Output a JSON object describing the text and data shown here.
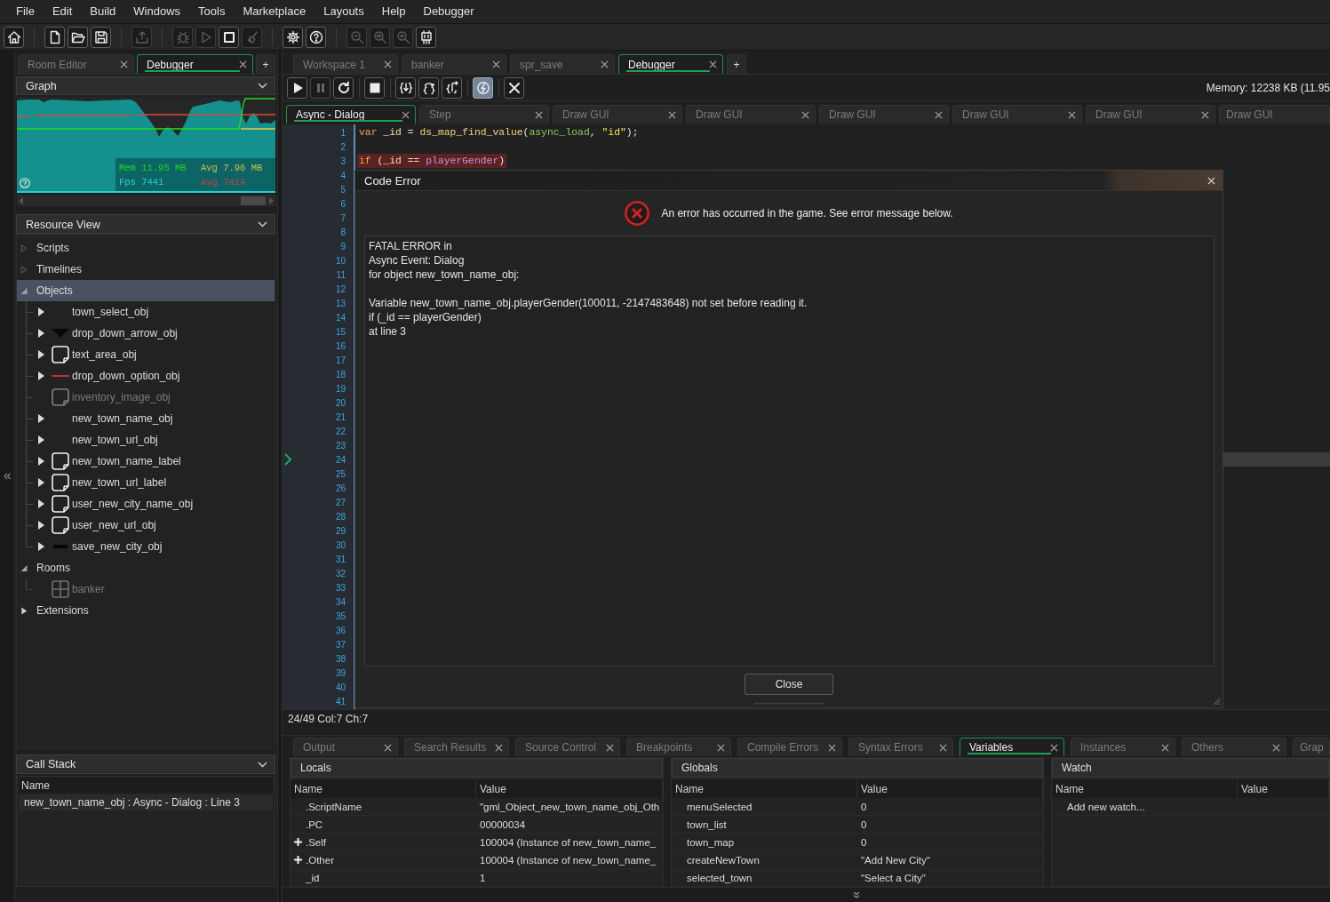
{
  "menu": [
    "File",
    "Edit",
    "Build",
    "Windows",
    "Tools",
    "Marketplace",
    "Layouts",
    "Help",
    "Debugger"
  ],
  "toolbar": [
    {
      "buttons": [
        {
          "kind": "home",
          "disabled": false
        }
      ]
    },
    {
      "buttons": [
        {
          "kind": "new",
          "disabled": false
        },
        {
          "kind": "open",
          "disabled": false
        },
        {
          "kind": "save",
          "disabled": false
        }
      ]
    },
    {
      "buttons": [
        {
          "kind": "export",
          "disabled": true
        }
      ]
    },
    {
      "buttons": [
        {
          "kind": "debug",
          "disabled": true
        },
        {
          "kind": "run",
          "disabled": true
        },
        {
          "kind": "stop",
          "disabled": false
        },
        {
          "kind": "clean",
          "disabled": true
        }
      ]
    },
    {
      "buttons": [
        {
          "kind": "settings",
          "disabled": false
        },
        {
          "kind": "help",
          "disabled": false
        }
      ]
    },
    {
      "buttons": [
        {
          "kind": "zoomout",
          "disabled": true
        },
        {
          "kind": "zoomreset",
          "disabled": true
        },
        {
          "kind": "zoomin",
          "disabled": true
        },
        {
          "kind": "device",
          "disabled": false
        }
      ]
    }
  ],
  "left_panel": {
    "tabs": [
      {
        "label": "Room Editor",
        "selected": false
      },
      {
        "label": "Debugger",
        "selected": true
      }
    ],
    "add_tab": "+",
    "graph": {
      "title": "Graph",
      "stats": [
        {
          "text": "Mem 11.95 MB",
          "color": "#22d422"
        },
        {
          "text": "Avg 7.96 MB",
          "color": "#c4c44a"
        },
        {
          "text": "Fps 7441",
          "color": "#30d0d0"
        },
        {
          "text": "Avg 7414",
          "color": "#d04040"
        }
      ]
    },
    "resource_view": {
      "title": "Resource View",
      "items": [
        {
          "label": "Scripts",
          "expanded": false,
          "empty": true,
          "selected": false
        },
        {
          "label": "Timelines",
          "expanded": false,
          "empty": true,
          "selected": false
        },
        {
          "label": "Objects",
          "expanded": true,
          "selected": true,
          "children": [
            {
              "label": "town_select_obj",
              "kind": "blank",
              "expandable": true,
              "dimmed": false,
              "selected": false
            },
            {
              "label": "drop_down_arrow_obj",
              "kind": "triangle",
              "expandable": true,
              "dimmed": false,
              "selected": false
            },
            {
              "label": "text_area_obj",
              "kind": "frame",
              "expandable": true,
              "dimmed": false,
              "selected": false
            },
            {
              "label": "drop_down_option_obj",
              "kind": "redline",
              "expandable": true,
              "dimmed": false,
              "selected": false
            },
            {
              "label": "inventory_image_obj",
              "kind": "frame",
              "expandable": false,
              "dimmed": true,
              "selected": false
            },
            {
              "label": "new_town_name_obj",
              "kind": "blank",
              "expandable": true,
              "dimmed": false,
              "selected": false
            },
            {
              "label": "new_town_url_obj",
              "kind": "blank",
              "expandable": true,
              "dimmed": false,
              "selected": false
            },
            {
              "label": "new_town_name_label",
              "kind": "frame",
              "expandable": true,
              "dimmed": false,
              "selected": false
            },
            {
              "label": "new_town_url_label",
              "kind": "frame",
              "expandable": true,
              "dimmed": false,
              "selected": false
            },
            {
              "label": "user_new_city_name_obj",
              "kind": "frame",
              "expandable": true,
              "dimmed": false,
              "selected": false
            },
            {
              "label": "user_new_url_obj",
              "kind": "frame",
              "expandable": true,
              "dimmed": false,
              "selected": false
            },
            {
              "label": "save_new_city_obj",
              "kind": "bar",
              "expandable": true,
              "dimmed": false,
              "selected": false
            }
          ]
        },
        {
          "label": "Rooms",
          "expanded": true,
          "selected": false,
          "children": [
            {
              "label": "banker",
              "kind": "room",
              "expandable": false,
              "dimmed": true,
              "selected": false
            }
          ]
        },
        {
          "label": "Extensions",
          "expanded": false,
          "empty": false,
          "selected": false
        }
      ]
    },
    "call_stack": {
      "title": "Call Stack",
      "column": "Name",
      "rows": [
        "new_town_name_obj : Async - Dialog : Line 3"
      ]
    }
  },
  "workspace_tabs": {
    "tabs": [
      {
        "label": "Workspace 1",
        "selected": false
      },
      {
        "label": "banker",
        "selected": false
      },
      {
        "label": "spr_save",
        "selected": false
      },
      {
        "label": "Debugger",
        "selected": true
      }
    ],
    "add_tab": "+"
  },
  "debug_toolbar": {
    "groups": [
      {
        "buttons": [
          {
            "kind": "play",
            "disabled": false,
            "pressed": false
          },
          {
            "kind": "pause",
            "disabled": true,
            "pressed": false
          },
          {
            "kind": "restart",
            "disabled": false,
            "pressed": false
          }
        ]
      },
      {
        "buttons": [
          {
            "kind": "stop",
            "disabled": false,
            "pressed": false
          }
        ]
      },
      {
        "buttons": [
          {
            "kind": "stepinto",
            "disabled": false,
            "pressed": false
          },
          {
            "kind": "stepover",
            "disabled": false,
            "pressed": false
          },
          {
            "kind": "stepout",
            "disabled": false,
            "pressed": false
          }
        ]
      },
      {
        "buttons": [
          {
            "kind": "realtime",
            "disabled": false,
            "pressed": true
          }
        ]
      },
      {
        "buttons": [
          {
            "kind": "close",
            "disabled": false,
            "pressed": false
          }
        ]
      }
    ],
    "memory": "Memory: 12238 KB (11.95"
  },
  "event_tabs": [
    {
      "label": "Async - Dialog",
      "selected": true
    },
    {
      "label": "Step",
      "selected": false
    },
    {
      "label": "Draw GUI",
      "selected": false
    },
    {
      "label": "Draw GUI",
      "selected": false
    },
    {
      "label": "Draw GUI",
      "selected": false
    },
    {
      "label": "Draw GUI",
      "selected": false
    },
    {
      "label": "Draw GUI",
      "selected": false
    },
    {
      "label": "Draw GUI",
      "selected": false
    }
  ],
  "editor": {
    "lines": [
      {
        "number": "1",
        "current": false,
        "code": {
          "error": false,
          "tokens": [
            {
              "kind": "keyword",
              "text": "var"
            },
            {
              "kind": "local",
              "text": " _id"
            },
            {
              "kind": "plain",
              "text": " = "
            },
            {
              "kind": "function",
              "text": "ds_map_find_value"
            },
            {
              "kind": "plain",
              "text": "("
            },
            {
              "kind": "builtin",
              "text": "async_load"
            },
            {
              "kind": "plain",
              "text": ", "
            },
            {
              "kind": "string",
              "text": "\"id\""
            },
            {
              "kind": "plain",
              "text": ");"
            }
          ]
        }
      },
      {
        "number": "2",
        "current": false
      },
      {
        "number": "3",
        "current": false,
        "code": {
          "error": true,
          "tokens": [
            {
              "kind": "keyword",
              "text": "if"
            },
            {
              "kind": "plain",
              "text": " ("
            },
            {
              "kind": "local",
              "text": "_id"
            },
            {
              "kind": "plain",
              "text": " == "
            },
            {
              "kind": "instance",
              "text": "playerGender"
            },
            {
              "kind": "plain",
              "text": ")"
            }
          ]
        }
      },
      {
        "number": "4",
        "current": false
      },
      {
        "number": "5",
        "current": false
      },
      {
        "number": "6",
        "current": false
      },
      {
        "number": "7",
        "current": false
      },
      {
        "number": "8",
        "current": false
      },
      {
        "number": "9",
        "current": false
      },
      {
        "number": "10",
        "current": false
      },
      {
        "number": "11",
        "current": false
      },
      {
        "number": "12",
        "current": false
      },
      {
        "number": "13",
        "current": false
      },
      {
        "number": "14",
        "current": false
      },
      {
        "number": "15",
        "current": false
      },
      {
        "number": "16",
        "current": false
      },
      {
        "number": "17",
        "current": false
      },
      {
        "number": "18",
        "current": false
      },
      {
        "number": "19",
        "current": false
      },
      {
        "number": "20",
        "current": false
      },
      {
        "number": "21",
        "current": false
      },
      {
        "number": "22",
        "current": false
      },
      {
        "number": "23",
        "current": false
      },
      {
        "number": "24",
        "current": true
      },
      {
        "number": "25",
        "current": false
      },
      {
        "number": "26",
        "current": false
      },
      {
        "number": "27",
        "current": false
      },
      {
        "number": "28",
        "current": false
      },
      {
        "number": "29",
        "current": false
      },
      {
        "number": "30",
        "current": false
      },
      {
        "number": "31",
        "current": false
      },
      {
        "number": "32",
        "current": false
      },
      {
        "number": "33",
        "current": false
      },
      {
        "number": "34",
        "current": false
      },
      {
        "number": "35",
        "current": false
      },
      {
        "number": "36",
        "current": false
      },
      {
        "number": "37",
        "current": false
      },
      {
        "number": "38",
        "current": false
      },
      {
        "number": "39",
        "current": false
      },
      {
        "number": "40",
        "current": false
      },
      {
        "number": "41",
        "current": false
      }
    ],
    "status": "24/49 Col:7 Ch:7"
  },
  "dialog": {
    "title": "Code Error",
    "message": "An error has occurred in the game. See error message below.",
    "details": "FATAL ERROR in\nAsync Event: Dialog\nfor object new_town_name_obj:\n\nVariable new_town_name_obj.playerGender(100011, -2147483648) not set before reading it.\nif (_id == playerGender)\nat line 3",
    "button": "Close"
  },
  "output_tabs": [
    {
      "label": "Output",
      "selected": false
    },
    {
      "label": "Search Results",
      "selected": false
    },
    {
      "label": "Source Control",
      "selected": false
    },
    {
      "label": "Breakpoints",
      "selected": false
    },
    {
      "label": "Compile Errors",
      "selected": false
    },
    {
      "label": "Syntax Errors",
      "selected": false
    },
    {
      "label": "Variables",
      "selected": true
    },
    {
      "label": "Instances",
      "selected": false
    },
    {
      "label": "Others",
      "selected": false
    },
    {
      "label": "Grap",
      "selected": false
    }
  ],
  "locals": {
    "title": "Locals",
    "columns": [
      "Name",
      "Value"
    ],
    "rows": [
      {
        "name": ".ScriptName",
        "value": "\"gml_Object_new_town_name_obj_Oth",
        "expandable": false
      },
      {
        "name": ".PC",
        "value": "00000034",
        "expandable": false
      },
      {
        "name": ".Self",
        "value": "100004 (Instance of new_town_name_",
        "expandable": true
      },
      {
        "name": ".Other",
        "value": "100004 (Instance of new_town_name_",
        "expandable": true
      },
      {
        "name": "_id",
        "value": "1",
        "expandable": false
      }
    ]
  },
  "globals": {
    "title": "Globals",
    "columns": [
      "Name",
      "Value"
    ],
    "rows": [
      {
        "name": "menuSelected",
        "value": "0"
      },
      {
        "name": "town_list",
        "value": "0"
      },
      {
        "name": "town_map",
        "value": "0"
      },
      {
        "name": "createNewTown",
        "value": "\"Add New City\""
      },
      {
        "name": "selected_town",
        "value": "\"Select a City\""
      }
    ]
  },
  "watch": {
    "title": "Watch",
    "columns": [
      "Name",
      "Value"
    ],
    "add_label": "Add new watch..."
  }
}
